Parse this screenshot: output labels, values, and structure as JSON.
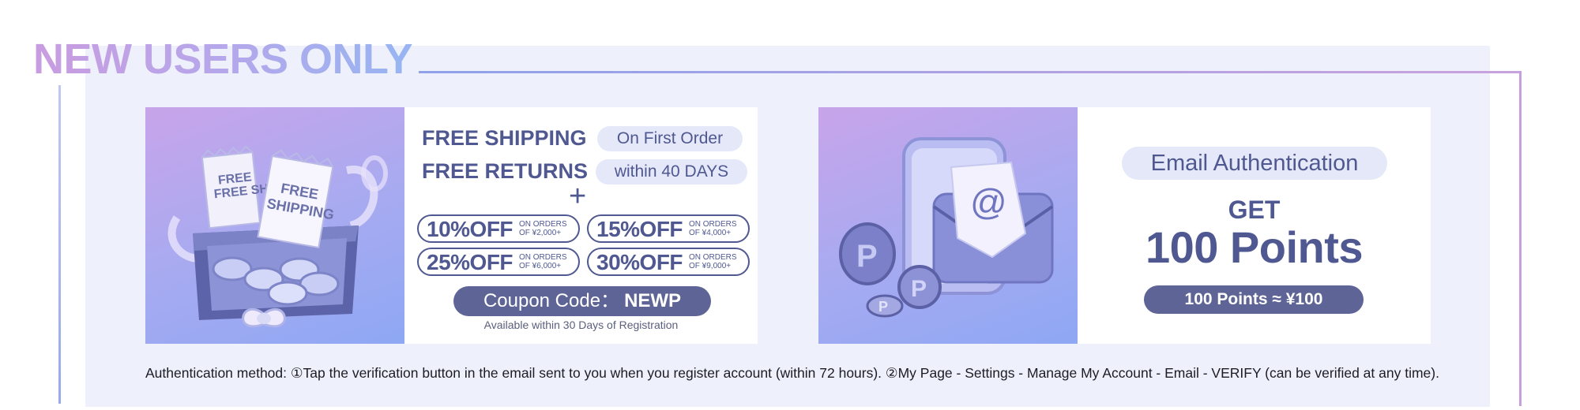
{
  "headline": "NEW USERS ONLY",
  "colors": {
    "primary": "#4f5890",
    "dark_pill": "#5e6496",
    "light_pill": "#e4e8f8",
    "panel_bg": "#eef1fb"
  },
  "card1": {
    "art_ticket_1": "FREE SHIPPIN",
    "art_ticket_2_line1": "FREE",
    "art_ticket_2_line2": "SHIPPING",
    "free_shipping": "FREE SHIPPING",
    "on_first_order": "On First Order",
    "free_returns": "FREE RETURNS",
    "within_days": "within 40 DAYS",
    "plus": "+",
    "discounts": [
      {
        "pct": "10%OFF",
        "cond_line1": "ON ORDERS",
        "cond_line2": "OF ¥2,000+"
      },
      {
        "pct": "15%OFF",
        "cond_line1": "ON ORDERS",
        "cond_line2": "OF ¥4,000+"
      },
      {
        "pct": "25%OFF",
        "cond_line1": "ON ORDERS",
        "cond_line2": "OF ¥6,000+"
      },
      {
        "pct": "30%OFF",
        "cond_line1": "ON ORDERS",
        "cond_line2": "OF ¥9,000+"
      }
    ],
    "coupon_label": "Coupon Code：",
    "coupon_code": "NEWP",
    "availability": "Available within 30 Days of Registration"
  },
  "card2": {
    "art_at_symbol": "@",
    "coin_letter": "P",
    "email_auth": "Email Authentication",
    "get": "GET",
    "points": "100 Points",
    "conversion": "100 Points ≈ ¥100"
  },
  "auth_note": "Authentication method: ①Tap the verification button in the email sent to you when you register account (within 72 hours). ②My Page - Settings - Manage My Account - Email - VERIFY (can be verified at any time)."
}
